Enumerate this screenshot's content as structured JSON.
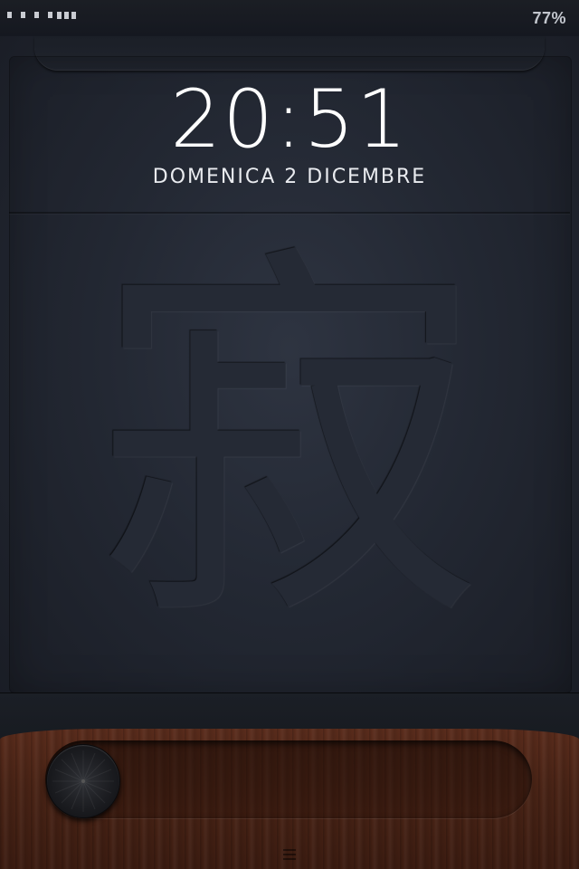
{
  "status_bar": {
    "battery_percent": "77%",
    "signal_strength_bars": 3
  },
  "lock_screen": {
    "time": "20:51",
    "date": "DOMENICA 2 DICEMBRE",
    "wallpaper_glyph": "寂"
  },
  "unlock_slider": {
    "knob_icon": "slider-knob-icon",
    "progress": 0
  },
  "icons": {
    "signal": "carrier-signal-icon",
    "bars": "signal-strength-icon",
    "grabber": "camera-grabber-icon"
  },
  "colors": {
    "text": "#ffffff",
    "leather": "#232833",
    "wood": "#4a2416"
  }
}
